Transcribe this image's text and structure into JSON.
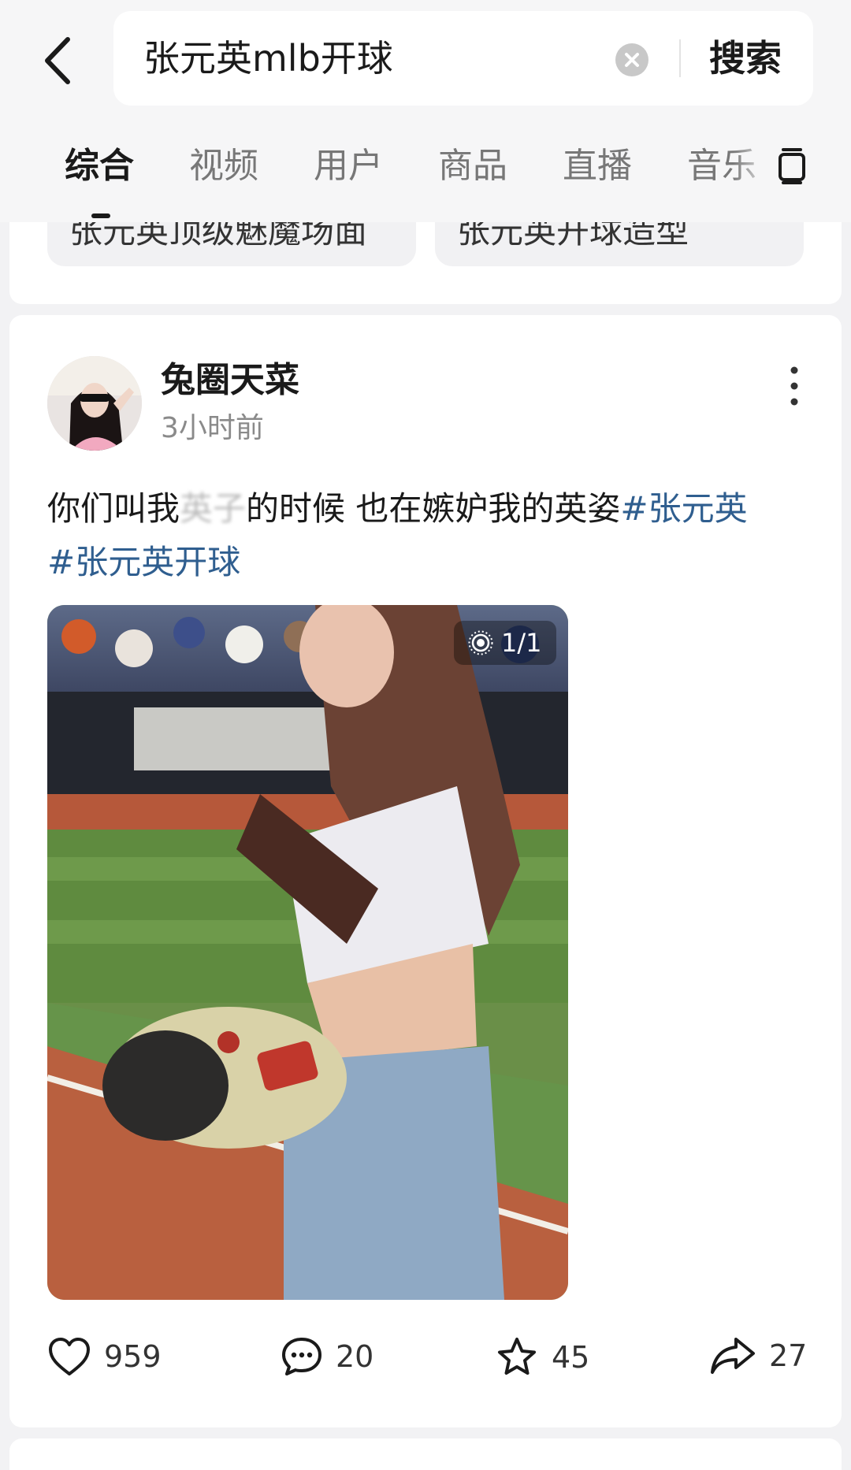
{
  "search": {
    "query": "张元英mlb开球",
    "submit_label": "搜索"
  },
  "tabs": [
    {
      "label": "综合",
      "active": true
    },
    {
      "label": "视频",
      "active": false
    },
    {
      "label": "用户",
      "active": false
    },
    {
      "label": "商品",
      "active": false
    },
    {
      "label": "直播",
      "active": false
    },
    {
      "label": "音乐",
      "active": false
    }
  ],
  "related_chips": [
    {
      "label": "张元英顶级魅魔场面"
    },
    {
      "label": "张元英开球造型"
    }
  ],
  "post": {
    "author": "兔圈天菜",
    "time": "3小时前",
    "text_before_blur": "你们叫我",
    "text_blurred": "英子",
    "text_after_blur": "的时候 也在嫉妒我的英姿",
    "hashtags": [
      "#张元英",
      "#张元英开球"
    ],
    "media_counter": "1/1",
    "likes": "959",
    "comments": "20",
    "favorites": "45",
    "shares": "27"
  },
  "icons": {
    "back": "back-arrow-icon",
    "clear": "clear-icon",
    "layout": "layout-icon",
    "more": "more-vertical-icon",
    "live_photo": "live-photo-icon",
    "like": "heart-icon",
    "comment": "comment-icon",
    "favorite": "star-icon",
    "share": "share-icon"
  },
  "colors": {
    "hashtag": "#2f5e8f",
    "background": "#f2f2f4"
  }
}
